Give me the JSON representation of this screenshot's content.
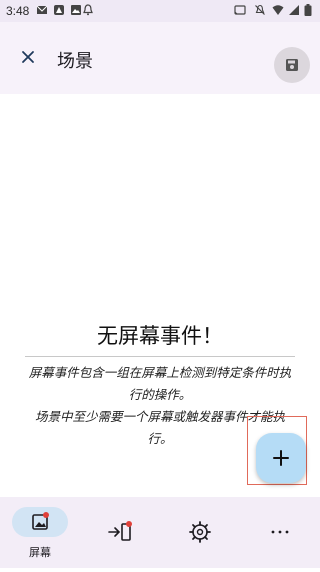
{
  "status": {
    "time": "3:48"
  },
  "appbar": {
    "title": "场景"
  },
  "empty": {
    "title": "无屏幕事件！",
    "line1": "屏幕事件包含一组在屏幕上检测到特定条件时执",
    "line2": "行的操作。",
    "line3": "场景中至少需要一个屏幕或触发器事件才能执",
    "line4": "行。"
  },
  "nav": {
    "screens_label": "屏幕"
  },
  "colors": {
    "accent": "#b5dcf6",
    "selected_pill": "#d2e4f4",
    "badge": "#e0413a"
  }
}
